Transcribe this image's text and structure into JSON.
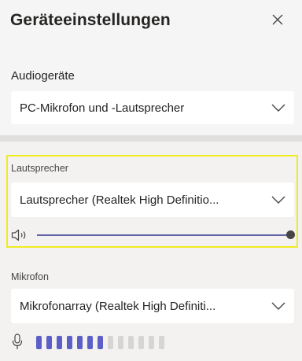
{
  "header": {
    "title": "Geräteeinstellungen",
    "close_icon": "close-icon"
  },
  "audio": {
    "label": "Audiogeräte",
    "selected": "PC-Mikrofon und -Lautsprecher"
  },
  "speaker": {
    "label": "Lautsprecher",
    "selected": "Lautsprecher (Realtek High Definitio...",
    "volume_icon": "speaker-icon",
    "volume_level": 1.0
  },
  "microphone": {
    "label": "Mikrofon",
    "selected": "Mikrofonarray (Realtek High Definiti...",
    "icon": "microphone-icon",
    "level_bars_total": 13,
    "level_bars_active": 7
  },
  "colors": {
    "accent": "#6264a7",
    "highlight": "#f0eb22",
    "bar_active": "#5b5fc7",
    "bar_inactive": "#d6d5d4"
  }
}
